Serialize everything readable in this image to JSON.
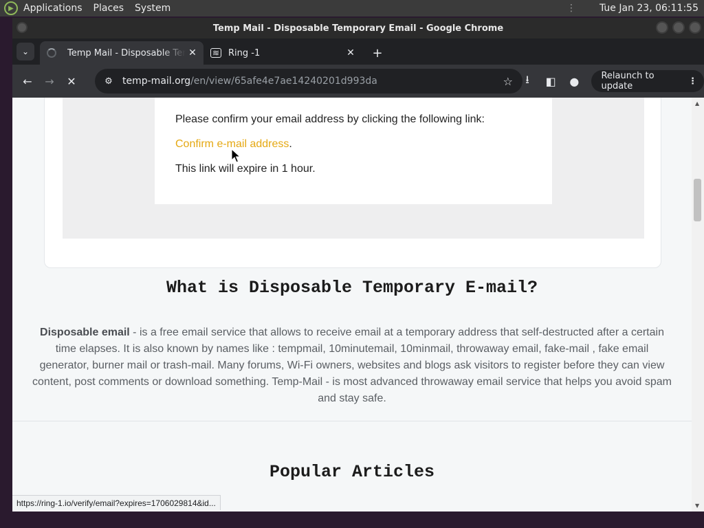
{
  "system_panel": {
    "menus": [
      "Applications",
      "Places",
      "System"
    ],
    "clock": "Tue Jan 23, 06:11:55"
  },
  "window": {
    "title": "Temp Mail - Disposable Temporary Email - Google Chrome"
  },
  "tabs": [
    {
      "label": "Temp Mail - Disposable Temporary Email",
      "state": "loading",
      "active": true
    },
    {
      "label": "Ring -1",
      "icon": "ring-icon",
      "active": false
    }
  ],
  "toolbar": {
    "url_host": "temp-mail.org",
    "url_path": "/en/view/65afe4e7ae14240201d993da",
    "relaunch_label": "Relaunch to update"
  },
  "email": {
    "line1": "Please confirm your email address by clicking the following link:",
    "link_text": "Confirm e-mail address",
    "link_suffix": ".",
    "line3": "This link will expire in 1 hour."
  },
  "content": {
    "what_heading": "What is Disposable Temporary E-mail?",
    "para_bold": "Disposable email",
    "para_rest": " - is a free email service that allows to receive email at a temporary address that self-destructed after a certain time elapses. It is also known by names like : tempmail, 10minutemail, 10minmail, throwaway email, fake-mail , fake email generator, burner mail or trash-mail. Many forums, Wi-Fi owners, websites and blogs ask visitors to register before they can view content, post comments or download something. Temp-Mail - is most advanced throwaway email service that helps you avoid spam and stay safe.",
    "popular_heading": "Popular Articles"
  },
  "status_bar": {
    "hover_url": "https://ring-1.io/verify/email?expires=1706029814&id..."
  },
  "colors": {
    "link": "#e5a812",
    "page_bg": "#f5f7f8",
    "chrome_dark": "#35363a"
  }
}
